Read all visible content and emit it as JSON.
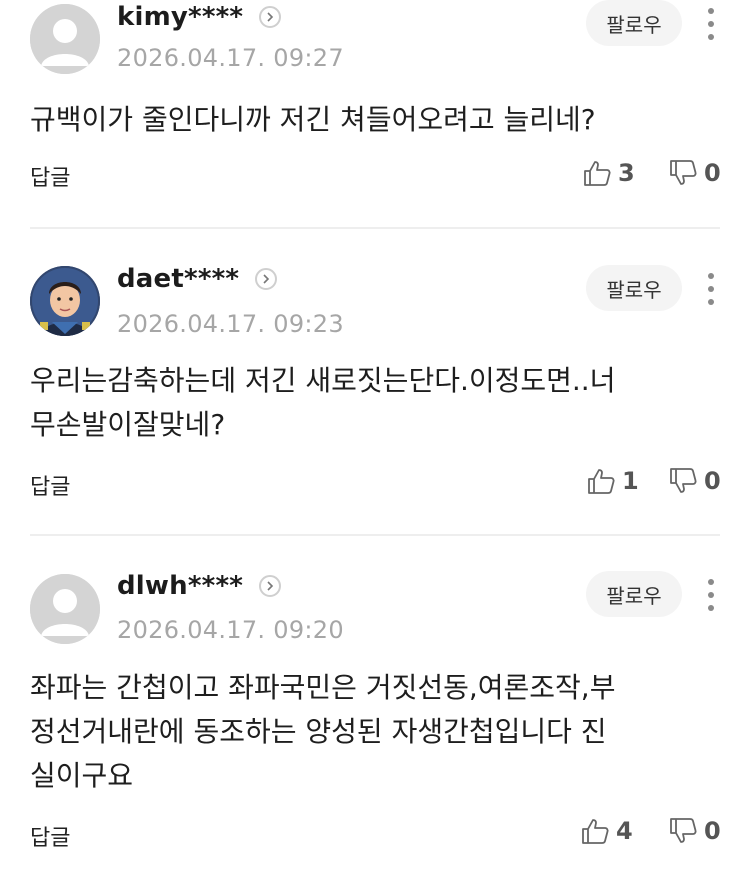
{
  "comments": [
    {
      "username": "kimy****",
      "timestamp": "2026.04.17. 09:27",
      "follow_label": "팔로우",
      "body": "규백이가 줄인다니까 저긴 쳐들어오려고 늘리네?",
      "reply_label": "답글",
      "likes": "3",
      "dislikes": "0",
      "avatar": "default-avatar"
    },
    {
      "username": "daet****",
      "timestamp": "2026.04.17. 09:23",
      "follow_label": "팔로우",
      "body": "우리는감축하는데 저긴 새로짓는단다.이정도면..너\n무손발이잘맞네?",
      "reply_label": "답글",
      "likes": "1",
      "dislikes": "0",
      "avatar": "photo-avatar"
    },
    {
      "username": "dlwh****",
      "timestamp": "2026.04.17. 09:20",
      "follow_label": "팔로우",
      "body": "좌파는 간첩이고 좌파국민은 거짓선동,여론조작,부\n정선거내란에 동조하는 양성된 자생간첩입니다 진\n실이구요",
      "reply_label": "답글",
      "likes": "4",
      "dislikes": "0",
      "avatar": "default-avatar"
    }
  ],
  "icons": {
    "like": "thumbs-up-icon",
    "dislike": "thumbs-down-icon",
    "more": "more-vertical-icon",
    "profile": "chevron-right-icon"
  }
}
